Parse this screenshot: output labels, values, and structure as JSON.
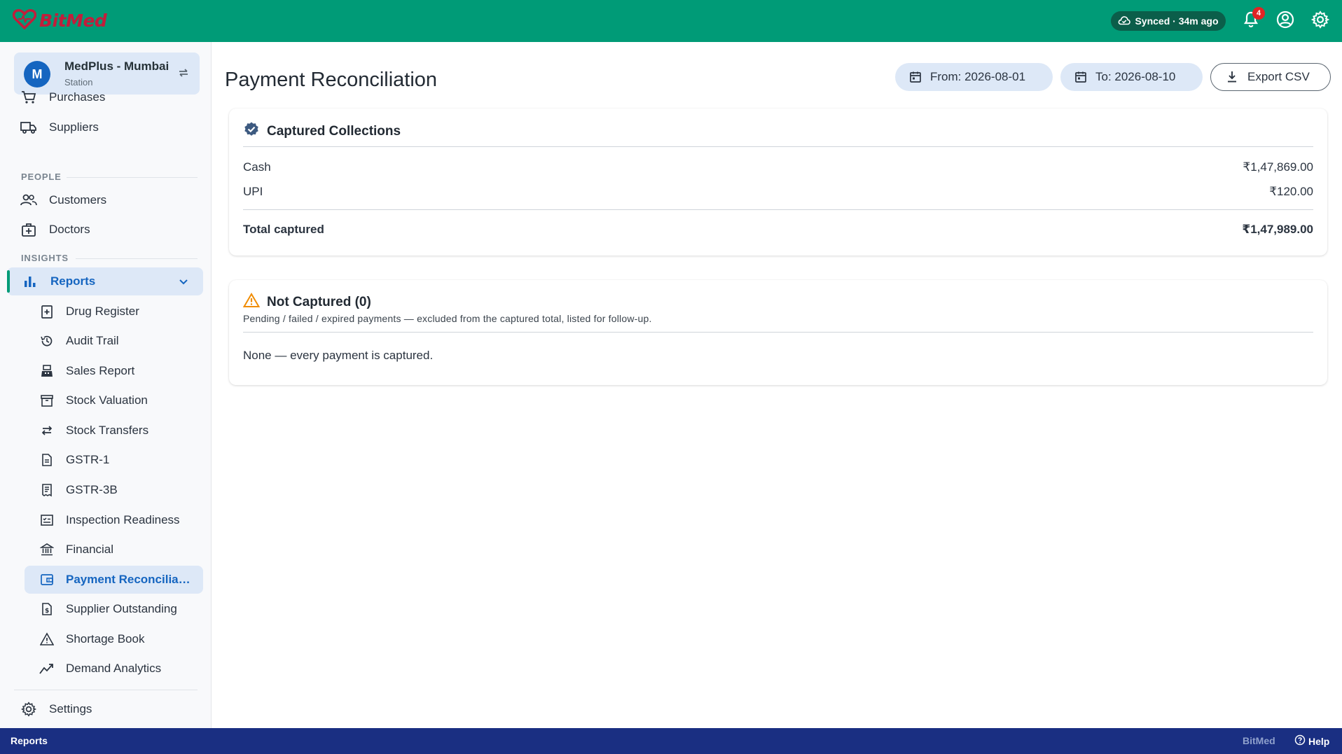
{
  "app": {
    "brand": "BitMed",
    "sync_status": "Synced · 34m ago",
    "notification_count": "4"
  },
  "sidebar": {
    "station": {
      "initial": "M",
      "name": "MedPlus - Mumbai",
      "subtitle": "Station"
    },
    "items_top": [
      {
        "label": "Purchases",
        "icon": "cart-icon"
      },
      {
        "label": "Suppliers",
        "icon": "truck-icon"
      }
    ],
    "sections": {
      "people": "PEOPLE",
      "insights": "INSIGHTS"
    },
    "people_items": [
      {
        "label": "Customers",
        "icon": "people-icon"
      },
      {
        "label": "Doctors",
        "icon": "medical-bag-icon"
      }
    ],
    "reports_label": "Reports",
    "reports_sub": [
      {
        "label": "Drug Register"
      },
      {
        "label": "Audit Trail"
      },
      {
        "label": "Sales Report"
      },
      {
        "label": "Stock Valuation"
      },
      {
        "label": "Stock Transfers"
      },
      {
        "label": "GSTR-1"
      },
      {
        "label": "GSTR-3B"
      },
      {
        "label": "Inspection Readiness"
      },
      {
        "label": "Financial"
      },
      {
        "label": "Payment Reconcilia…"
      },
      {
        "label": "Supplier Outstanding"
      },
      {
        "label": "Shortage Book"
      },
      {
        "label": "Demand Analytics"
      }
    ],
    "settings_label": "Settings"
  },
  "main": {
    "title": "Payment Reconciliation",
    "from_label": "From: 2026-08-01",
    "to_label": "To: 2026-08-10",
    "export_label": "Export CSV",
    "captured": {
      "title": "Captured Collections",
      "rows": [
        {
          "label": "Cash",
          "value": "₹1,47,869.00"
        },
        {
          "label": "UPI",
          "value": "₹120.00"
        }
      ],
      "total_label": "Total captured",
      "total_value": "₹1,47,989.00"
    },
    "not_captured": {
      "title": "Not Captured (0)",
      "description": "Pending / failed / expired payments — excluded from the captured total, listed for follow-up.",
      "empty_message": "None — every payment is captured."
    }
  },
  "footer": {
    "section": "Reports",
    "brand": "BitMed",
    "help": "Help"
  },
  "colors": {
    "header_green": "#009b77",
    "accent_blue": "#1565c0",
    "active_bg": "#dde8f7",
    "footer_navy": "#1a2f82",
    "warning_orange": "#f08c00"
  }
}
